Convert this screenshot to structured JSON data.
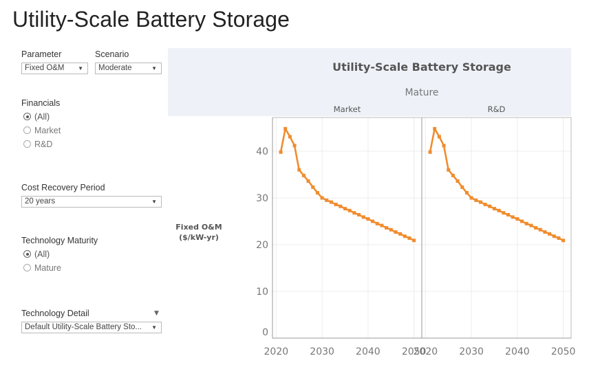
{
  "page": {
    "title": "Utility-Scale Battery Storage"
  },
  "filters": {
    "parameter": {
      "label": "Parameter",
      "value": "Fixed O&M"
    },
    "scenario": {
      "label": "Scenario",
      "value": "Moderate"
    },
    "financials": {
      "label": "Financials",
      "options": [
        {
          "label": "(All)",
          "selected": true
        },
        {
          "label": "Market",
          "selected": false
        },
        {
          "label": "R&D",
          "selected": false
        }
      ]
    },
    "cost_recovery": {
      "label": "Cost Recovery Period",
      "value": "20 years"
    },
    "maturity": {
      "label": "Technology Maturity",
      "options": [
        {
          "label": "(All)",
          "selected": true
        },
        {
          "label": "Mature",
          "selected": false
        }
      ]
    },
    "detail": {
      "label": "Technology Detail",
      "value": "Default Utility-Scale Battery Sto...",
      "menu_icon": "dropdown-caret-icon"
    }
  },
  "colors": {
    "line": "#f08c2e",
    "header_bg": "#eef2f8",
    "grid": "#ececec",
    "axis": "#999999"
  },
  "chart_data": {
    "type": "line",
    "title": "Utility-Scale Battery Storage",
    "column_header": "Mature",
    "panes": [
      "Market",
      "R&D"
    ],
    "xlabel": "",
    "ylabel": "Fixed O&M\n($/kW-yr)",
    "ylabel_lines": [
      "Fixed O&M",
      "($/kW-yr)"
    ],
    "ylim": [
      0,
      47.2
    ],
    "xlim": [
      2019.2,
      2051.7
    ],
    "yticks": [
      0,
      10,
      20,
      30,
      40
    ],
    "xticks": [
      2020,
      2030,
      2040,
      2050
    ],
    "grid": true,
    "x": [
      2021,
      2022,
      2023,
      2024,
      2025,
      2026,
      2027,
      2028,
      2029,
      2030,
      2031,
      2032,
      2033,
      2034,
      2035,
      2036,
      2037,
      2038,
      2039,
      2040,
      2041,
      2042,
      2043,
      2044,
      2045,
      2046,
      2047,
      2048,
      2049,
      2050
    ],
    "series": [
      {
        "name": "Market",
        "values": [
          39.8,
          44.8,
          43.1,
          41.2,
          36.0,
          34.8,
          33.6,
          32.3,
          31.1,
          30.0,
          29.5,
          29.1,
          28.6,
          28.2,
          27.7,
          27.3,
          26.8,
          26.4,
          25.9,
          25.5,
          25.0,
          24.5,
          24.1,
          23.6,
          23.2,
          22.7,
          22.3,
          21.8,
          21.4,
          20.9
        ]
      },
      {
        "name": "R&D",
        "values": [
          39.8,
          44.8,
          43.1,
          41.2,
          36.0,
          34.8,
          33.6,
          32.3,
          31.1,
          30.0,
          29.5,
          29.1,
          28.6,
          28.2,
          27.7,
          27.3,
          26.8,
          26.4,
          25.9,
          25.5,
          25.0,
          24.5,
          24.1,
          23.6,
          23.2,
          22.7,
          22.3,
          21.8,
          21.4,
          20.9
        ]
      }
    ]
  }
}
